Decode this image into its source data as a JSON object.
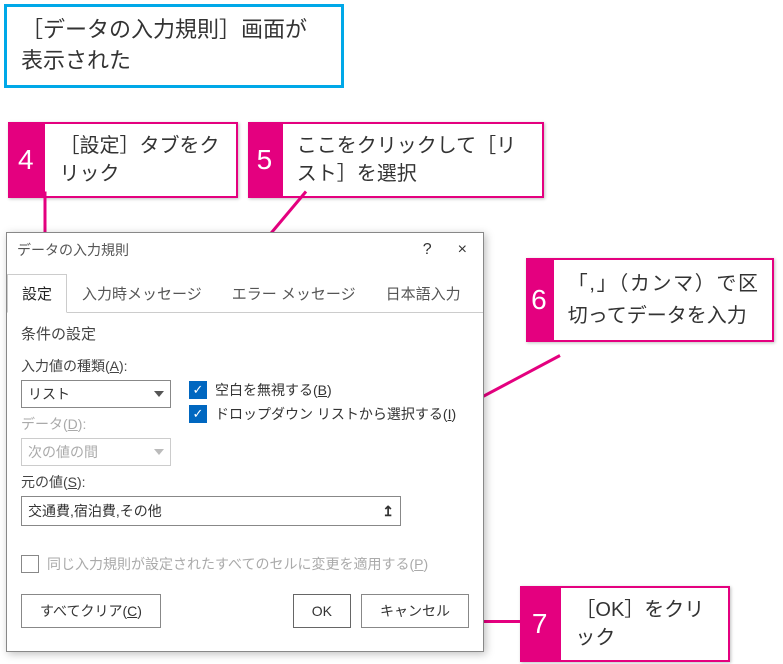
{
  "caption": "［データの入力規則］画面が表示された",
  "callouts": {
    "c4": {
      "num": "4",
      "text": "［設定］タブをクリック"
    },
    "c5": {
      "num": "5",
      "text": "ここをクリックして［リスト］を選択"
    },
    "c6": {
      "num": "6",
      "text": "「,」（カンマ）で区切ってデータを入力"
    },
    "c7": {
      "num": "7",
      "text": "［OK］をクリック"
    }
  },
  "dialog": {
    "title": "データの入力規則",
    "help": "?",
    "close": "×",
    "tabs": [
      "設定",
      "入力時メッセージ",
      "エラー メッセージ",
      "日本語入力"
    ],
    "section": "条件の設定",
    "type_label": "入力値の種類(A):",
    "type_value": "リスト",
    "data_label": "データ(D):",
    "data_value": "次の値の間",
    "ignore_blank": "空白を無視する(B)",
    "in_cell_dd": "ドロップダウン リストから選択する(I)",
    "source_label": "元の値(S):",
    "source_value": "交通費,宿泊費,その他",
    "apply_all": "同じ入力規則が設定されたすべてのセルに変更を適用する(P)",
    "clear": "すべてクリア(C)",
    "ok": "OK",
    "cancel": "キャンセル"
  }
}
